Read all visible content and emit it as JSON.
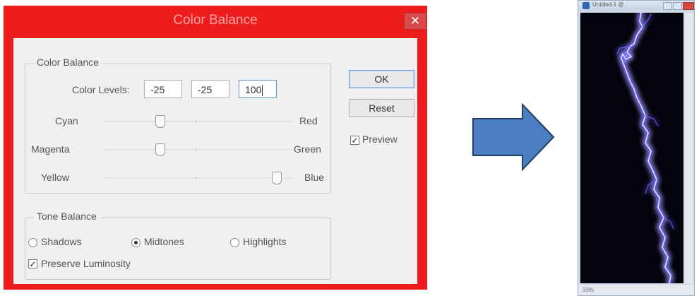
{
  "colors": {
    "dialog_frame": "#ee1d1d",
    "dialog_client": "#f0f0f0",
    "arrow_fill": "#4a7ec0",
    "arrow_stroke": "#1f3f66",
    "canvas_bg": "#04030d",
    "lightning": "#7f76ff"
  },
  "dialog": {
    "title": "Color Balance",
    "close_icon": "close-icon",
    "color_balance_group": {
      "legend": "Color Balance",
      "levels_label": "Color Levels:",
      "levels": [
        "-25",
        "-25",
        "100"
      ],
      "sliders": [
        {
          "left": "Cyan",
          "right": "Red",
          "value": -25
        },
        {
          "left": "Magenta",
          "right": "Green",
          "value": -25
        },
        {
          "left": "Yellow",
          "right": "Blue",
          "value": 100
        }
      ]
    },
    "tone_balance_group": {
      "legend": "Tone Balance",
      "options": [
        "Shadows",
        "Midtones",
        "Highlights"
      ],
      "selected": "Midtones",
      "preserve_luminosity": {
        "label": "Preserve Luminosity",
        "checked": true
      }
    },
    "buttons": {
      "ok": "OK",
      "reset": "Reset"
    },
    "preview": {
      "label": "Preview",
      "checked": true
    }
  },
  "arrow": {
    "icon": "right-arrow-icon"
  },
  "document_window": {
    "title": "Untitled-1 @",
    "zoom": "33%",
    "image": "lightning-bolt"
  }
}
